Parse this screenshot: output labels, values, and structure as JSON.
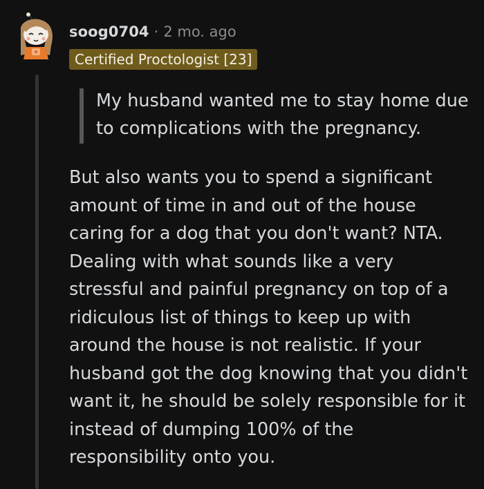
{
  "comment": {
    "author": "soog0704",
    "separator": "·",
    "time_ago": "2 mo. ago",
    "flair": "Certified Proctologist [23]",
    "quote": "My husband wanted me to stay home due to complications with the pregnancy.",
    "body": "But also wants you to spend a significant amount of time in and out of the house caring for a dog that you don't want? NTA. Dealing with what sounds like a very stressful and painful pregnancy on top of a ridiculous list of things to keep up with around the house is not realistic. If your husband got the dog knowing that you didn't want it, he should be solely responsible for it instead of dumping 100% of the responsibility onto you."
  },
  "colors": {
    "background": "#111112",
    "flair_background": "#6f5c1c",
    "text": "#d7dadc",
    "meta": "#8a8c8e",
    "thread_line": "#343436"
  },
  "icons": {
    "avatar": "snoo-avatar-icon"
  }
}
